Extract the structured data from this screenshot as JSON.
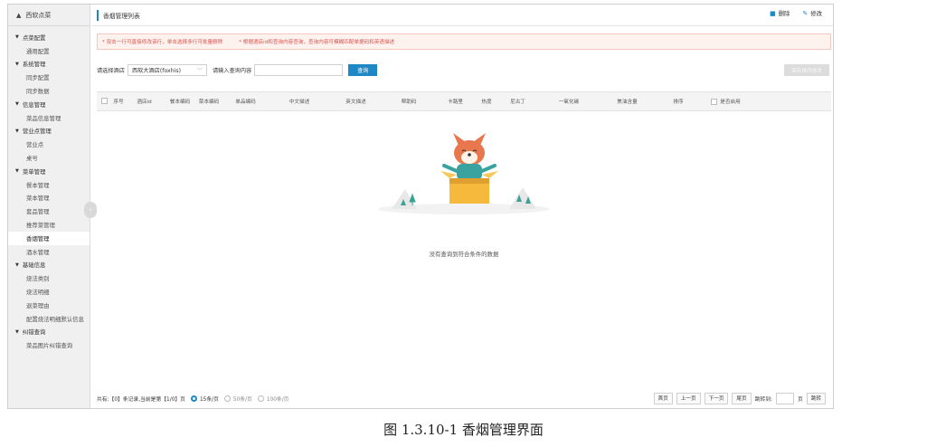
{
  "sidebar": {
    "header": "西软点菜",
    "menu": [
      {
        "type": "group",
        "label": "点菜配置"
      },
      {
        "type": "item",
        "label": "通用配置"
      },
      {
        "type": "group",
        "label": "系统管理"
      },
      {
        "type": "item",
        "label": "同步配置"
      },
      {
        "type": "item",
        "label": "同步数据"
      },
      {
        "type": "group",
        "label": "信息管理"
      },
      {
        "type": "item",
        "label": "菜品信息管理"
      },
      {
        "type": "group",
        "label": "营业点管理"
      },
      {
        "type": "item",
        "label": "营业点"
      },
      {
        "type": "item",
        "label": "桌号"
      },
      {
        "type": "group",
        "label": "菜单管理"
      },
      {
        "type": "item",
        "label": "餐本管理"
      },
      {
        "type": "item",
        "label": "菜本管理"
      },
      {
        "type": "item",
        "label": "套品管理"
      },
      {
        "type": "item",
        "label": "推荐菜管理"
      },
      {
        "type": "item",
        "label": "香烟管理",
        "active": true
      },
      {
        "type": "item",
        "label": "酒水管理"
      },
      {
        "type": "group",
        "label": "基础信息"
      },
      {
        "type": "item",
        "label": "烧法类别"
      },
      {
        "type": "item",
        "label": "烧法明细"
      },
      {
        "type": "item",
        "label": "退菜理由"
      },
      {
        "type": "item",
        "label": "配置烧法明细默认信息"
      },
      {
        "type": "group",
        "label": "纠错查询"
      },
      {
        "type": "item",
        "label": "菜品图片纠错查询"
      }
    ]
  },
  "topbar": {
    "title": "香烟管理列表",
    "delete_label": "删除",
    "edit_label": "修改"
  },
  "notice": {
    "tip1": "* 双击一行可直接修改该行，单击选择多行可批量删除",
    "tip2": "* 根据酒店id和查询内容查询，查询内容可模糊匹配单据码和英语描述"
  },
  "filters": {
    "hotel_label": "请选择酒店",
    "hotel_value": "西软大酒店(foxhis)",
    "query_label": "请输入查询内容",
    "query_button": "查询",
    "right_button": "保存排序修改"
  },
  "table": {
    "columns": [
      "序号",
      "酒店id",
      "餐本编码",
      "菜本编码",
      "单品编码",
      "中文描述",
      "英文描述",
      "帮助码",
      "卡路里",
      "热度",
      "尼古丁",
      "一氧化碳",
      "焦油含量",
      "排序",
      "是否启用"
    ],
    "empty_text": "没有查询到符合条件的数据"
  },
  "footer": {
    "summary": "共有:【0】条记录,当前是第【1/0】页",
    "size_options": [
      "15条/页",
      "50条/页",
      "100条/页"
    ],
    "selected_size_index": 0,
    "first": "首页",
    "prev": "上一页",
    "next": "下一页",
    "last": "尾页",
    "goto_label": "跳转到:",
    "page_unit": "页",
    "goto_button": "跳转"
  },
  "caption": "图 1.3.10-1 香烟管理界面"
}
